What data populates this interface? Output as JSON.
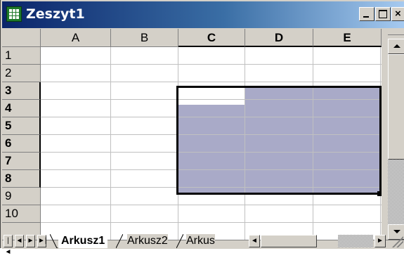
{
  "window": {
    "title": "Zeszyt1",
    "icon": "excel-workbook-icon"
  },
  "titlebar_buttons": {
    "minimize": "minimize-icon",
    "maximize": "maximize-icon",
    "close_label": "×"
  },
  "columns": [
    "A",
    "B",
    "C",
    "D",
    "E"
  ],
  "selected_columns": [
    "C",
    "D",
    "E"
  ],
  "rows": [
    "1",
    "2",
    "3",
    "4",
    "5",
    "6",
    "7",
    "8",
    "9",
    "10"
  ],
  "selected_rows": [
    "3",
    "4",
    "5",
    "6",
    "7",
    "8"
  ],
  "selection": {
    "range": "C3:E8",
    "active_cell": "C3",
    "fill_color": "#a9aac8"
  },
  "sheet_tabs": {
    "nav": [
      "|◄",
      "◄",
      "►",
      "►|"
    ],
    "tabs": [
      "Arkusz1",
      "Arkusz2",
      "Arkus"
    ],
    "active": "Arkusz1"
  },
  "hscroll": {
    "left_arrow": "◄",
    "right_arrow": "►"
  }
}
